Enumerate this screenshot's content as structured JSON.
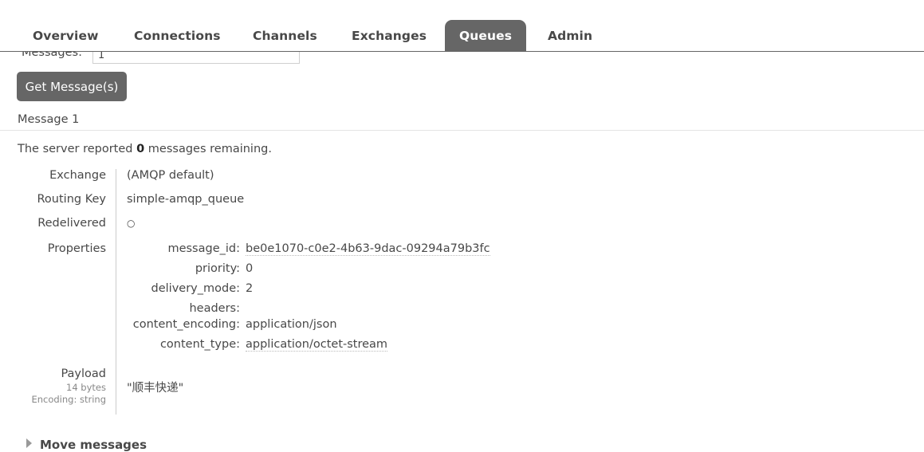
{
  "nav": {
    "tabs": [
      {
        "label": "Overview"
      },
      {
        "label": "Connections"
      },
      {
        "label": "Channels"
      },
      {
        "label": "Exchanges"
      },
      {
        "label": "Queues"
      },
      {
        "label": "Admin"
      }
    ],
    "active_tab": "Queues"
  },
  "get_messages": {
    "messages_label": "Messages:",
    "messages_value": "1",
    "button_label": "Get Message(s)"
  },
  "message": {
    "title": "Message 1",
    "server_text_before": "The server reported ",
    "remaining_count": "0",
    "server_text_after": " messages remaining.",
    "exchange_label": "Exchange",
    "exchange_value": "(AMQP default)",
    "routing_key_label": "Routing Key",
    "routing_key_value": "simple-amqp_queue",
    "redelivered_label": "Redelivered",
    "redelivered_value": "○",
    "properties_label": "Properties",
    "properties": [
      {
        "key": "message_id:",
        "value": "be0e1070-c0e2-4b63-9dac-09294a79b3fc"
      },
      {
        "key": "priority:",
        "value": "0"
      },
      {
        "key": "delivery_mode:",
        "value": "2"
      },
      {
        "key": "headers:",
        "value": ""
      },
      {
        "key": "content_encoding:",
        "value": "application/json"
      },
      {
        "key": "content_type:",
        "value": "application/octet-stream"
      }
    ],
    "payload_label": "Payload",
    "payload_size": "14 bytes",
    "payload_encoding": "Encoding: string",
    "payload_value": "\"顺丰快递\""
  },
  "move_messages": {
    "label": "Move messages"
  },
  "colors": {
    "active_tab_bg": "#666666",
    "button_bg": "#666666",
    "text": "#484848"
  }
}
